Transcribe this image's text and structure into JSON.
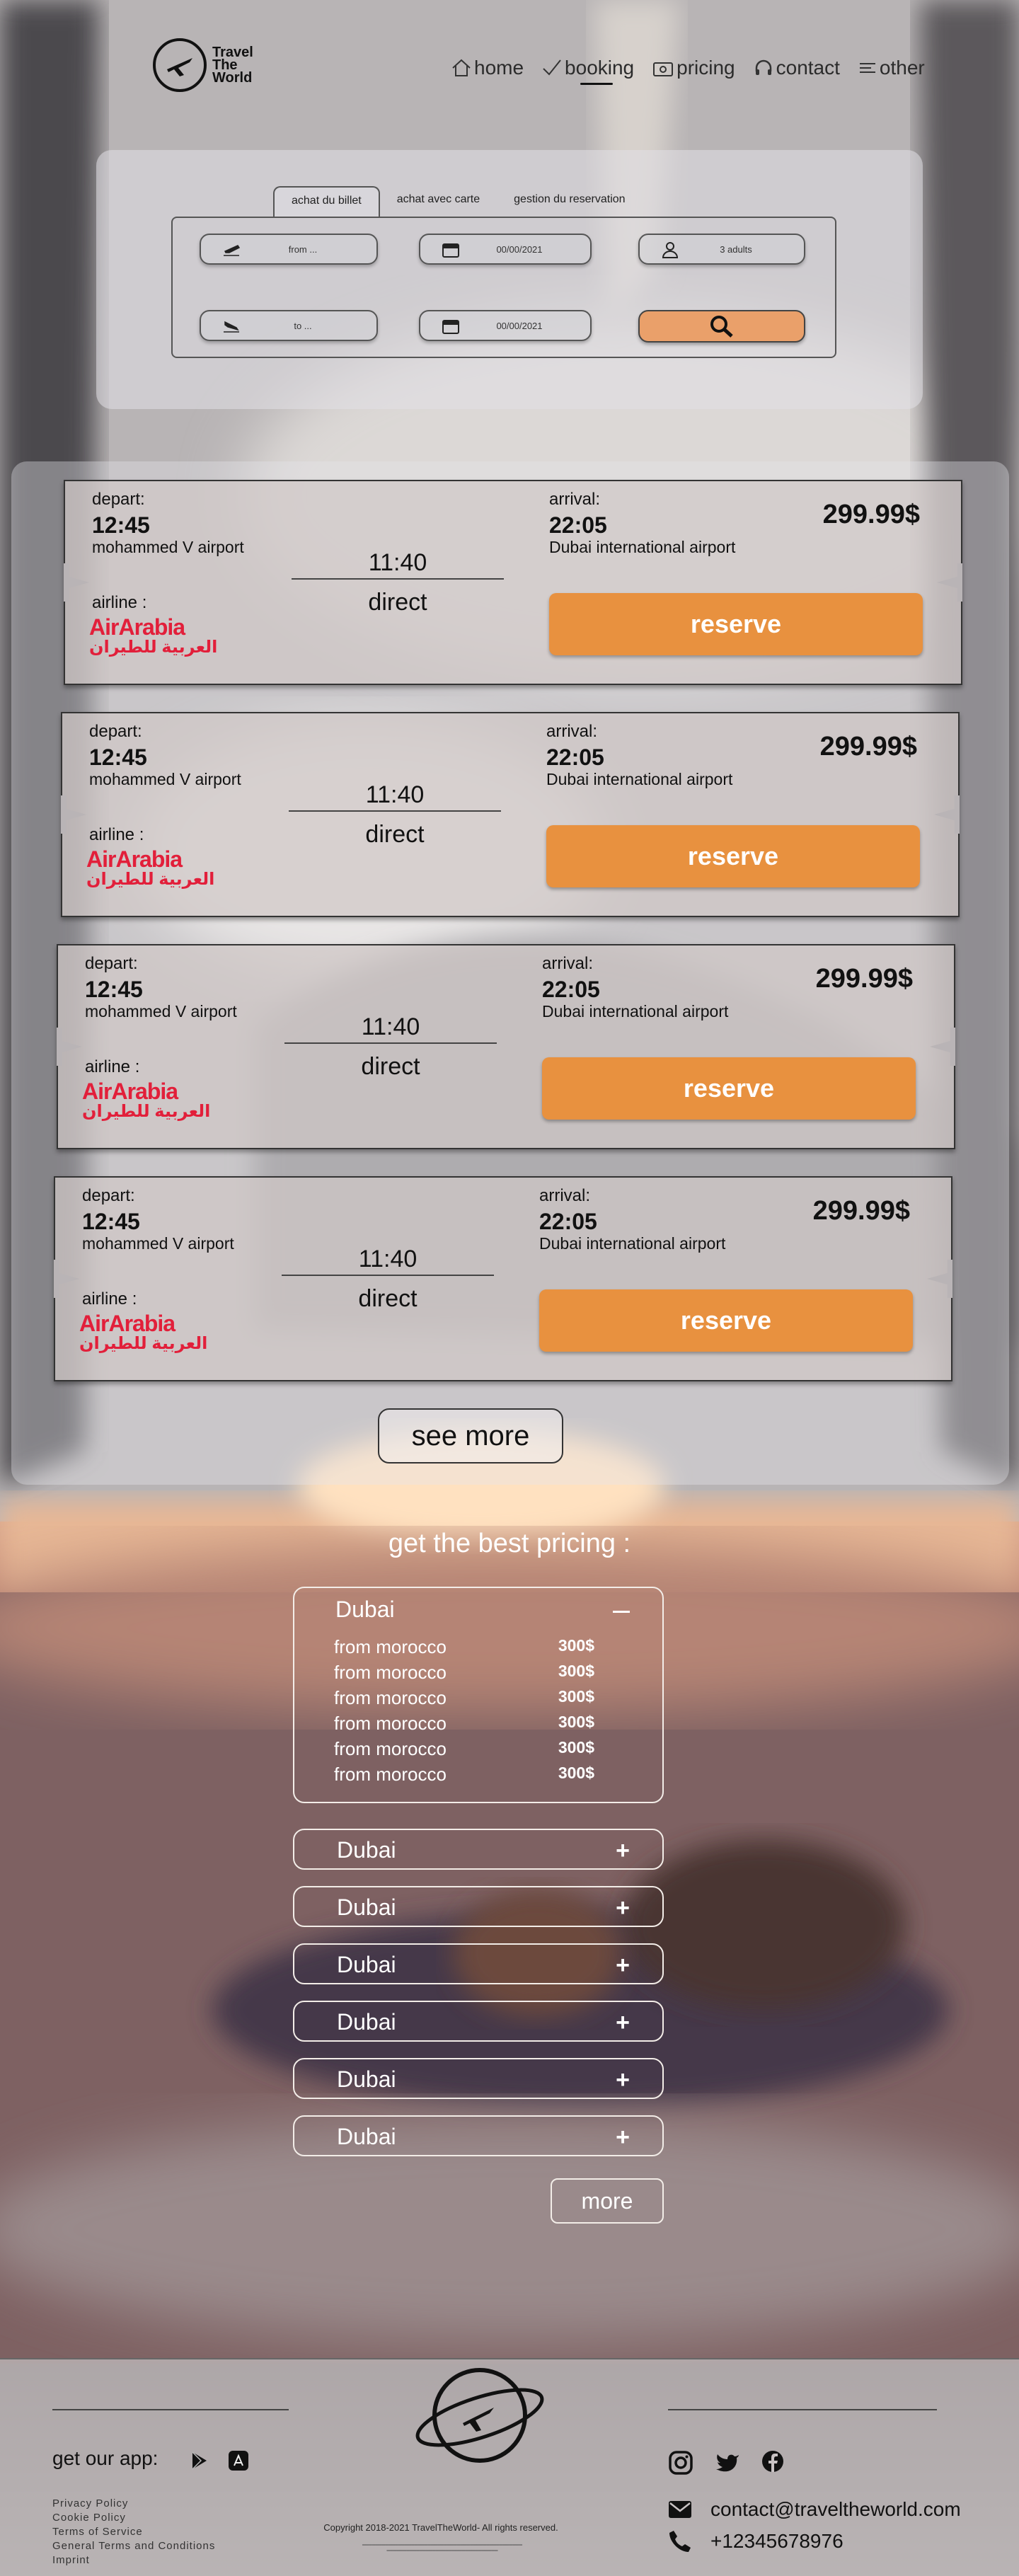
{
  "brand": {
    "line1": "Travel",
    "line2": "The",
    "line3": "World"
  },
  "nav": [
    {
      "label": "home",
      "icon": "home-icon"
    },
    {
      "label": "booking",
      "icon": "check-icon"
    },
    {
      "label": "pricing",
      "icon": "wallet-icon"
    },
    {
      "label": "contact",
      "icon": "headset-icon"
    },
    {
      "label": "other",
      "icon": "menu-icon"
    }
  ],
  "search": {
    "tabs": [
      "achat du billet",
      "achat avec carte",
      "gestion du reservation"
    ],
    "from_placeholder": "from ...",
    "to_placeholder": "to ...",
    "depart_date": "00/00/2021",
    "return_date": "00/00/2021",
    "passengers": "3 adults"
  },
  "flights": [
    {
      "depart_label": "depart:",
      "depart_time": "12:45",
      "depart_airport": "mohammed V airport",
      "airline_label": "airline :",
      "airline_en": "AirArabia",
      "airline_ar": "العربية للطيران",
      "duration": "11:40",
      "type": "direct",
      "arrival_label": "arrival:",
      "arrival_time": "22:05",
      "arrival_airport": "Dubai international airport",
      "price": "299.99$",
      "cta": "reserve"
    },
    {
      "depart_label": "depart:",
      "depart_time": "12:45",
      "depart_airport": "mohammed V airport",
      "airline_label": "airline :",
      "airline_en": "AirArabia",
      "airline_ar": "العربية للطيران",
      "duration": "11:40",
      "type": "direct",
      "arrival_label": "arrival:",
      "arrival_time": "22:05",
      "arrival_airport": "Dubai international airport",
      "price": "299.99$",
      "cta": "reserve"
    },
    {
      "depart_label": "depart:",
      "depart_time": "12:45",
      "depart_airport": "mohammed V airport",
      "airline_label": "airline :",
      "airline_en": "AirArabia",
      "airline_ar": "العربية للطيران",
      "duration": "11:40",
      "type": "direct",
      "arrival_label": "arrival:",
      "arrival_time": "22:05",
      "arrival_airport": "Dubai international airport",
      "price": "299.99$",
      "cta": "reserve"
    },
    {
      "depart_label": "depart:",
      "depart_time": "12:45",
      "depart_airport": "mohammed V airport",
      "airline_label": "airline :",
      "airline_en": "AirArabia",
      "airline_ar": "العربية للطيران",
      "duration": "11:40",
      "type": "direct",
      "arrival_label": "arrival:",
      "arrival_time": "22:05",
      "arrival_airport": "Dubai international airport",
      "price": "299.99$",
      "cta": "reserve"
    }
  ],
  "see_more": "see more",
  "pricing": {
    "title": "get the best pricing :",
    "open": {
      "destination": "Dubai",
      "rows": [
        {
          "from": "from morocco",
          "price": "300$"
        },
        {
          "from": "from morocco",
          "price": "300$"
        },
        {
          "from": "from morocco",
          "price": "300$"
        },
        {
          "from": "from morocco",
          "price": "300$"
        },
        {
          "from": "from morocco",
          "price": "300$"
        },
        {
          "from": "from morocco",
          "price": "300$"
        }
      ]
    },
    "collapsed": [
      "Dubai",
      "Dubai",
      "Dubai",
      "Dubai",
      "Dubai",
      "Dubai"
    ],
    "more": "more"
  },
  "footer": {
    "get_app": "get our app:",
    "links": [
      "Privacy Policy",
      "Cookie Policy",
      "Terms of Service",
      "General Terms and Conditions",
      "Imprint"
    ],
    "copyright": "Copyright 2018-2021 TravelTheWorld- All rights reserved.",
    "email": "contact@traveltheworld.com",
    "phone": "+12345678976"
  }
}
